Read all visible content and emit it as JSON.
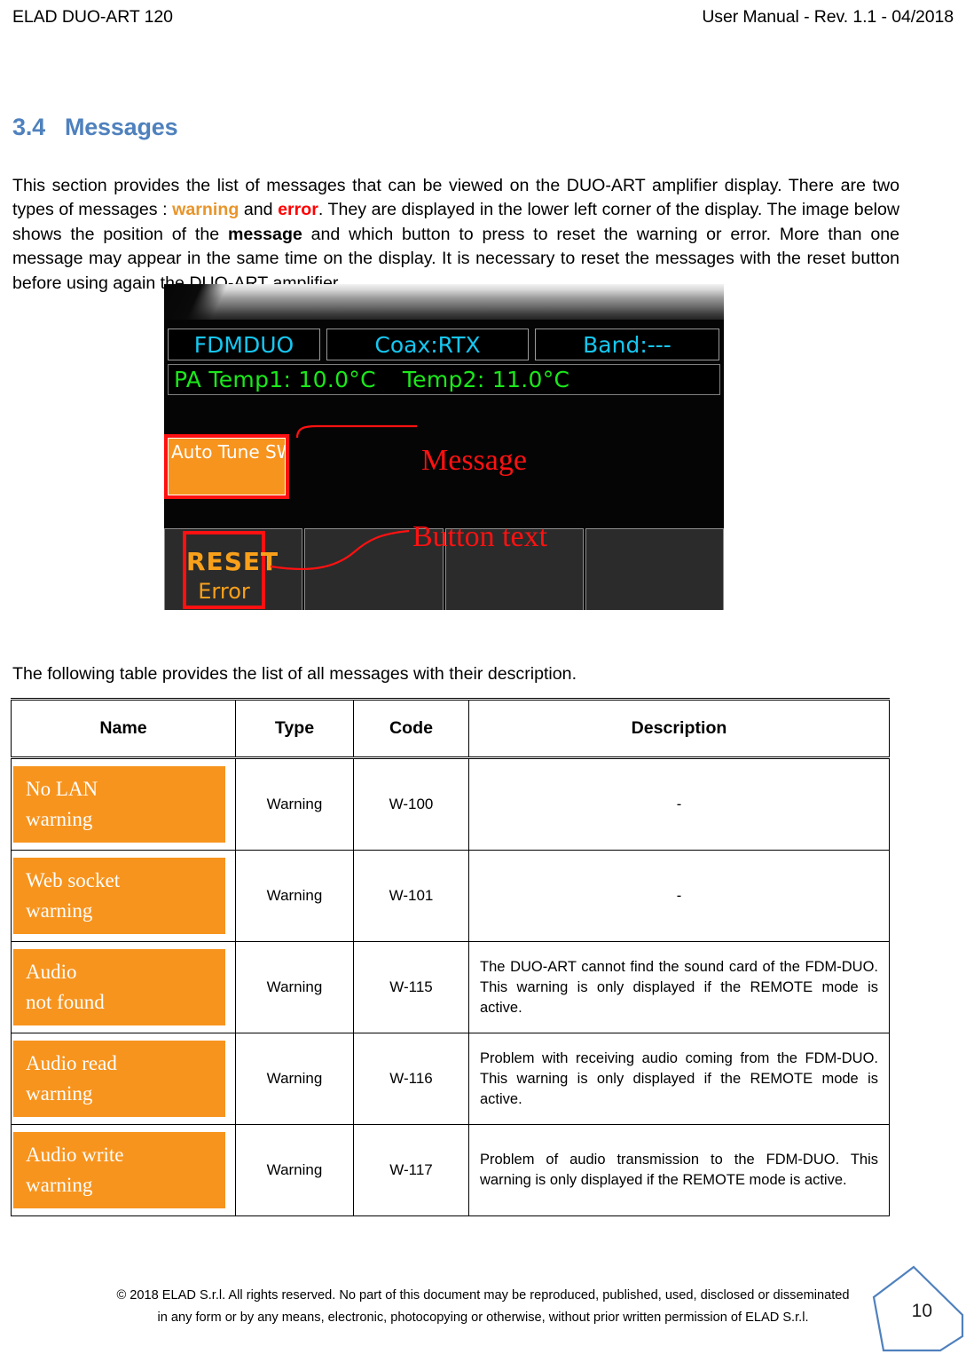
{
  "header": {
    "left": "ELAD DUO-ART 120",
    "right": "User Manual - Rev. 1.1 - 04/2018"
  },
  "heading": {
    "number": "3.4",
    "title": "Messages",
    "color": "#4F81BD"
  },
  "intro": {
    "part1": "This section provides the list of messages that can be viewed on the DUO-ART amplifier display. There are two types of messages : ",
    "warning_word": "warning",
    "part2": " and ",
    "error_word": "error",
    "part3": ". They are displayed in the lower left corner of the display. The image below shows the position of the ",
    "message_word": "message",
    "part4": " and which button to press to reset the warning or error. More than one message may appear in the same time on the display. It is necessary to reset the messages with the reset button before using again the DUO-ART amplifier.",
    "warning_color": "#E8952B",
    "error_color": "#FF0000"
  },
  "display": {
    "status": {
      "source": "FDMDUO",
      "coax": "Coax:RTX",
      "band": "Band:---"
    },
    "temps": {
      "temp1": "PA Temp1:  10.0°C",
      "temp2": "Temp2:  11.0°C"
    },
    "warning_box": {
      "line1": "Auto Tune",
      "line2": "SWR  warning",
      "bg_color": "#F7941E"
    },
    "reset_button": {
      "line1": "RESET",
      "line2": "Error",
      "color": "#F9A01B"
    },
    "annotations": {
      "message": "Message",
      "button_text": "Button text",
      "color": "#FF1111"
    }
  },
  "table_intro": "The following table provides the list of all messages with their description.",
  "table": {
    "columns": [
      "Name",
      "Type",
      "Code",
      "Description"
    ],
    "rows": [
      {
        "name_line1": "No LAN",
        "name_line2": "warning",
        "type": "Warning",
        "code": "W-100",
        "description": "-"
      },
      {
        "name_line1": "Web socket",
        "name_line2": "warning",
        "type": "Warning",
        "code": "W-101",
        "description": "-"
      },
      {
        "name_line1": "Audio",
        "name_line2": "not found",
        "type": "Warning",
        "code": "W-115",
        "description": "The DUO-ART cannot find the sound card of the FDM-DUO. This warning is only displayed if the REMOTE mode is active."
      },
      {
        "name_line1": "Audio read",
        "name_line2": "warning",
        "type": "Warning",
        "code": "W-116",
        "description": "Problem with receiving audio coming from the FDM-DUO. This warning is only displayed if the REMOTE mode is active."
      },
      {
        "name_line1": "Audio write",
        "name_line2": "warning",
        "type": "Warning",
        "code": "W-117",
        "description": "Problem of audio transmission to the FDM-DUO. This warning is only displayed if the REMOTE mode is active."
      }
    ],
    "badge_color": "#F7941E"
  },
  "footer": {
    "line1": "© 2018 ELAD S.r.l. All rights reserved. No part of this document may be reproduced, published, used, disclosed or disseminated",
    "line2": "in any form or by any means, electronic, photocopying or otherwise, without prior written permission of ELAD S.r.l.",
    "page_number": "10",
    "badge_color": "#4F81BD"
  }
}
